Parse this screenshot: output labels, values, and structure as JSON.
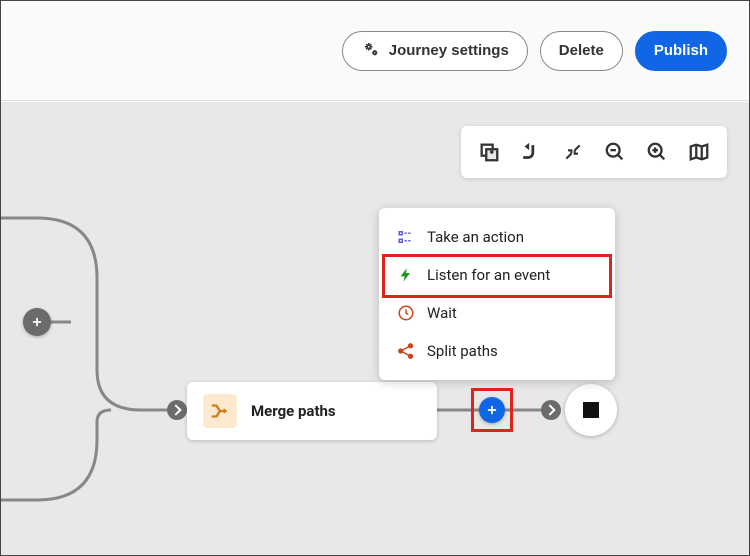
{
  "header": {
    "journey_settings_label": "Journey settings",
    "delete_label": "Delete",
    "publish_label": "Publish"
  },
  "canvas": {
    "merge_paths_label": "Merge paths"
  },
  "popover": {
    "items": [
      {
        "label": "Take an action"
      },
      {
        "label": "Listen for an event"
      },
      {
        "label": "Wait"
      },
      {
        "label": "Split paths"
      }
    ]
  }
}
